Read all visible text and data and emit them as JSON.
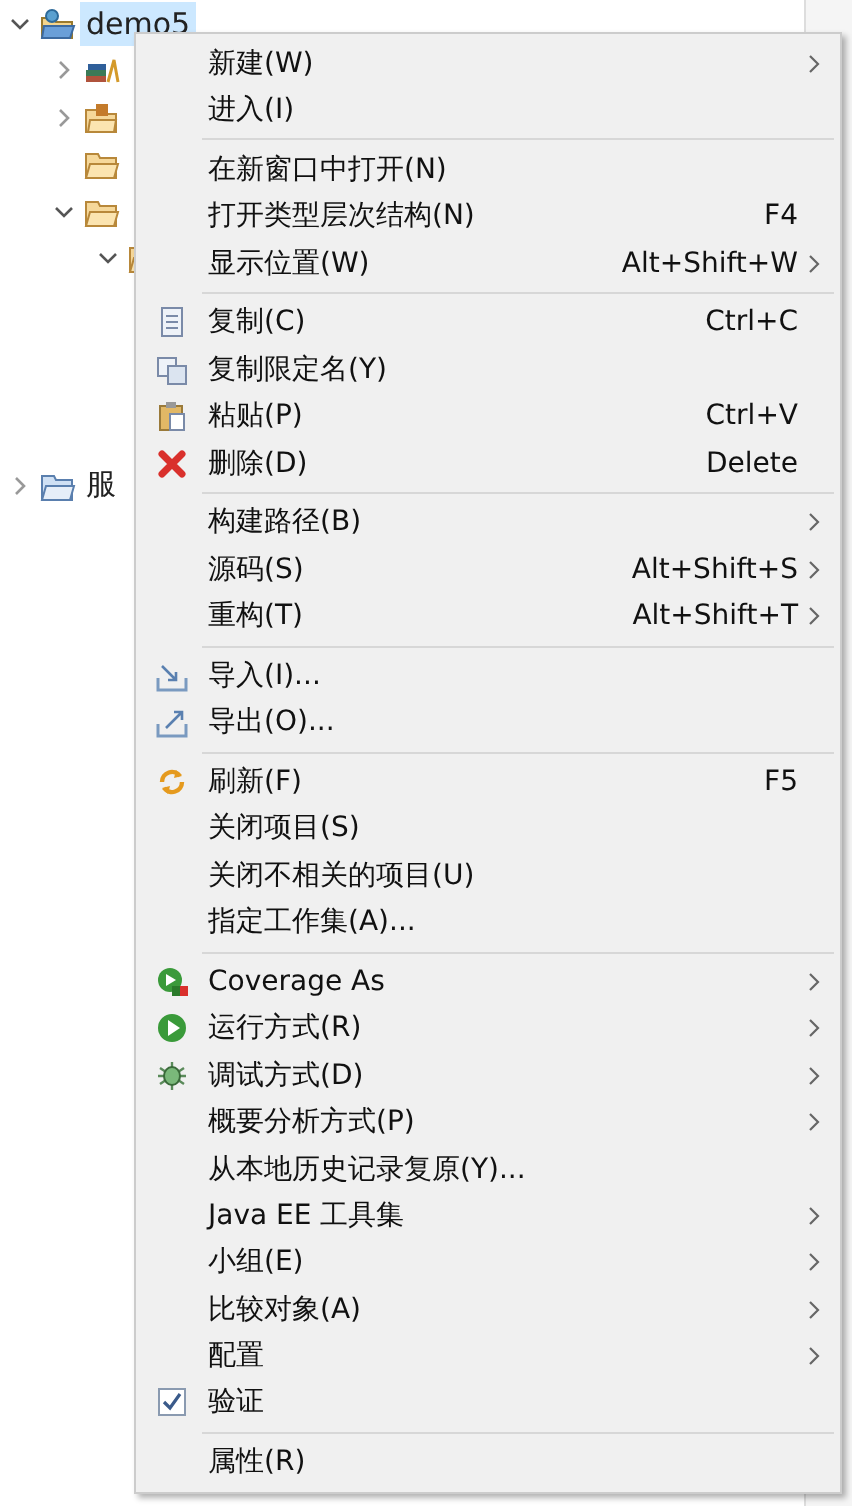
{
  "tree": [
    {
      "label": "demo5",
      "kind": "project",
      "selected": true,
      "expanded": true,
      "children": [
        {
          "kind": "library",
          "expanded": false
        },
        {
          "kind": "package-folder",
          "expanded": false
        },
        {
          "kind": "folder"
        },
        {
          "kind": "folder",
          "expanded": true,
          "children": [
            {
              "kind": "folder",
              "expanded": true
            }
          ]
        }
      ]
    },
    {
      "label": "服",
      "kind": "folder",
      "selected": false,
      "expanded": false
    }
  ],
  "menu": {
    "groups": [
      [
        {
          "label": "新建(W)",
          "submenu": true
        },
        {
          "label": "进入(I)",
          "submenu": false
        }
      ],
      [
        {
          "label": "在新窗口中打开(N)",
          "submenu": false
        },
        {
          "label": "打开类型层次结构(N)",
          "shortcut": "F4",
          "submenu": false
        },
        {
          "label": "显示位置(W)",
          "shortcut": "Alt+Shift+W",
          "submenu": true
        }
      ],
      [
        {
          "label": "复制(C)",
          "kind": "copy",
          "shortcut": "Ctrl+C",
          "submenu": false
        },
        {
          "label": "复制限定名(Y)",
          "kind": "copy-name",
          "submenu": false
        },
        {
          "label": "粘贴(P)",
          "kind": "paste",
          "shortcut": "Ctrl+V",
          "submenu": false
        },
        {
          "label": "删除(D)",
          "kind": "delete",
          "shortcut": "Delete",
          "submenu": false
        }
      ],
      [
        {
          "label": "构建路径(B)",
          "submenu": true
        },
        {
          "label": "源码(S)",
          "shortcut": "Alt+Shift+S",
          "submenu": true
        },
        {
          "label": "重构(T)",
          "shortcut": "Alt+Shift+T",
          "submenu": true
        }
      ],
      [
        {
          "label": "导入(I)...",
          "kind": "import",
          "submenu": false
        },
        {
          "label": "导出(O)...",
          "kind": "export",
          "submenu": false
        }
      ],
      [
        {
          "label": "刷新(F)",
          "kind": "refresh",
          "shortcut": "F5",
          "submenu": false
        },
        {
          "label": "关闭项目(S)",
          "submenu": false
        },
        {
          "label": "关闭不相关的项目(U)",
          "submenu": false
        },
        {
          "label": "指定工作集(A)...",
          "submenu": false
        }
      ],
      [
        {
          "label": "Coverage As",
          "kind": "coverage",
          "submenu": true
        },
        {
          "label": "运行方式(R)",
          "kind": "run",
          "submenu": true
        },
        {
          "label": "调试方式(D)",
          "kind": "debug",
          "submenu": true
        },
        {
          "label": "概要分析方式(P)",
          "submenu": true
        },
        {
          "label": "从本地历史记录复原(Y)...",
          "submenu": false
        },
        {
          "label": "Java EE 工具集",
          "submenu": true
        },
        {
          "label": "小组(E)",
          "submenu": true
        },
        {
          "label": "比较对象(A)",
          "submenu": true
        },
        {
          "label": "配置",
          "submenu": true
        },
        {
          "label": "验证",
          "kind": "check",
          "checked": true,
          "submenu": false
        }
      ],
      [
        {
          "label": "属性(R)",
          "submenu": false
        }
      ]
    ]
  }
}
